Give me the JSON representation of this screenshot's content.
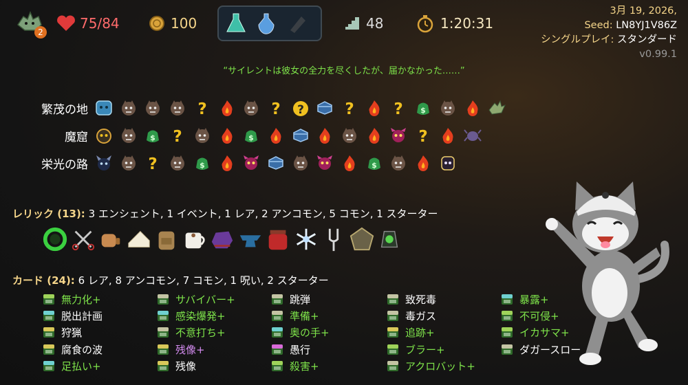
{
  "top": {
    "ascension": "2",
    "hp": "75/84",
    "gold": "100",
    "floor": "48",
    "time": "1:20:31",
    "date": "3月 19, 2026,",
    "seed_label": "Seed:",
    "seed": "LN8YJ1V86Z",
    "mode_label": "シングルプレイ:",
    "mode": "スタンダード",
    "version": "v0.99.1"
  },
  "quote": "“サイレントは彼女の全力を尽くしたが、届かなかった……”",
  "map": {
    "acts": [
      {
        "label": "繁茂の地",
        "nodes": [
          "boss-blue",
          "monster",
          "monster",
          "monster",
          "unknown",
          "rest",
          "monster",
          "unknown",
          "elite-unknown",
          "treasure",
          "unknown",
          "rest",
          "unknown",
          "merchant",
          "monster",
          "rest",
          "boss-dragon"
        ]
      },
      {
        "label": "魔窟",
        "nodes": [
          "boss-skull",
          "monster",
          "merchant",
          "unknown",
          "monster",
          "rest",
          "merchant",
          "rest",
          "treasure",
          "rest",
          "monster",
          "rest",
          "elite",
          "unknown",
          "rest",
          "boss-spider"
        ]
      },
      {
        "label": "栄光の路",
        "nodes": [
          "boss-horned",
          "monster",
          "unknown",
          "monster",
          "merchant",
          "rest",
          "elite",
          "treasure",
          "monster",
          "elite",
          "rest",
          "merchant",
          "monster",
          "rest",
          "boss-ghost"
        ]
      }
    ]
  },
  "relics": {
    "label": "レリック (13):",
    "summary": "3 エンシェント, 1 イベント, 1 レア, 2 アンコモン, 5 コモン, 1 スターター",
    "items": [
      "ring-snake",
      "scissors",
      "tea-set",
      "cheese",
      "backpack",
      "cocoa-mug",
      "bag-purple",
      "anvil",
      "jar-red",
      "snowflake",
      "tuning-fork",
      "pentagon-shield",
      "lantern"
    ]
  },
  "cards": {
    "label": "カード (24):",
    "summary": "6 レア, 8 アンコモン, 7 コモン, 1 呪い, 2 スターター",
    "columns": [
      [
        {
          "name": "無力化+",
          "style": "up",
          "icon": "#9fd35a"
        },
        {
          "name": "脱出計画",
          "style": "norm",
          "icon": "#6fd0d0"
        },
        {
          "name": "狩猟",
          "style": "norm",
          "icon": "#d9c85a"
        },
        {
          "name": "腐食の波",
          "style": "norm",
          "icon": "#d9c85a"
        },
        {
          "name": "足払い+",
          "style": "up",
          "icon": "#6fd0d0"
        }
      ],
      [
        {
          "name": "サバイバー+",
          "style": "up",
          "icon": "#c4c4a4"
        },
        {
          "name": "感染爆発+",
          "style": "up",
          "icon": "#6fd0d0"
        },
        {
          "name": "不意打ち+",
          "style": "up",
          "icon": "#c4c4a4"
        },
        {
          "name": "残像+",
          "style": "purple",
          "icon": "#d9c85a"
        },
        {
          "name": "残像",
          "style": "norm",
          "icon": "#d9c85a"
        }
      ],
      [
        {
          "name": "跳弾",
          "style": "norm",
          "icon": "#c4c4a4"
        },
        {
          "name": "準備+",
          "style": "up",
          "icon": "#c4c4a4"
        },
        {
          "name": "奥の手+",
          "style": "up",
          "icon": "#6fd0d0"
        },
        {
          "name": "愚行",
          "style": "norm",
          "icon": "#d86ad8"
        },
        {
          "name": "殺害+",
          "style": "up",
          "icon": "#9fd35a"
        }
      ],
      [
        {
          "name": "致死毒",
          "style": "norm",
          "icon": "#c4c4a4"
        },
        {
          "name": "毒ガス",
          "style": "norm",
          "icon": "#c4c4a4"
        },
        {
          "name": "追跡+",
          "style": "up",
          "icon": "#d9c85a"
        },
        {
          "name": "ブラー+",
          "style": "up",
          "icon": "#9fd35a"
        },
        {
          "name": "アクロバット+",
          "style": "up",
          "icon": "#c4c4a4"
        }
      ],
      [
        {
          "name": "暴露+",
          "style": "up",
          "icon": "#6fd0d0"
        },
        {
          "name": "不可侵+",
          "style": "up",
          "icon": "#9fd35a"
        },
        {
          "name": "イカサマ+",
          "style": "up",
          "icon": "#9fd35a"
        },
        {
          "name": "ダガースロー",
          "style": "norm",
          "icon": "#c4c4a4"
        }
      ]
    ]
  }
}
